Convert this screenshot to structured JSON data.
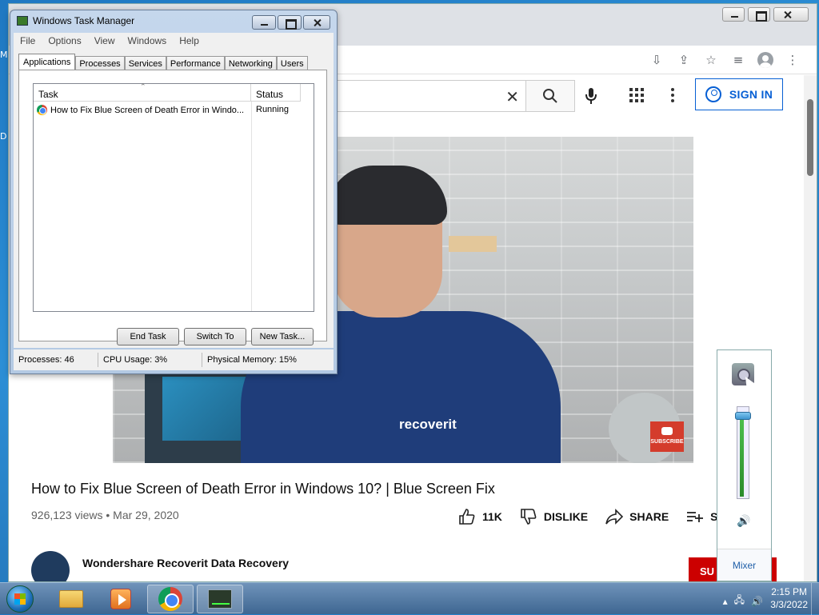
{
  "desktop": {
    "left_fragments": [
      "M",
      "D"
    ]
  },
  "browser": {
    "search": {
      "clear_icon": "close-icon"
    },
    "header": {
      "signin_label": "SIGN IN"
    },
    "video": {
      "logo_text": "recoverit",
      "subscribe_badge": "SUBSCRIBE",
      "title": "How to Fix Blue Screen of Death Error in Windows 10? | Blue Screen Fix",
      "meta": "926,123 views • Mar 29, 2020",
      "actions": {
        "like_count": "11K",
        "dislike_label": "DISLIKE",
        "share_label": "SHARE",
        "save_label": "SA"
      },
      "channel_name": "Wondershare Recoverit Data Recovery",
      "subscribe_button": "SU"
    }
  },
  "task_manager": {
    "title": "Windows Task Manager",
    "menu": [
      "File",
      "Options",
      "View",
      "Windows",
      "Help"
    ],
    "tabs": [
      "Applications",
      "Processes",
      "Services",
      "Performance",
      "Networking",
      "Users"
    ],
    "active_tab": "Applications",
    "columns": {
      "task": "Task",
      "status": "Status"
    },
    "rows": [
      {
        "task": "How to Fix Blue Screen of Death Error in Windo...",
        "status": "Running"
      }
    ],
    "buttons": {
      "end_task": "End Task",
      "switch_to": "Switch To",
      "new_task": "New Task..."
    },
    "statusbar": {
      "processes": "Processes: 46",
      "cpu": "CPU Usage: 3%",
      "memory": "Physical Memory: 15%"
    }
  },
  "volume_popup": {
    "level_percent": 95,
    "mixer_label": "Mixer"
  },
  "taskbar": {
    "clock": {
      "time": "2:15 PM",
      "date": "3/3/2022"
    },
    "pinned": [
      "folder-icon",
      "media-player-icon",
      "chrome-icon",
      "task-manager-icon"
    ]
  },
  "colors": {
    "accent": "#065fd4",
    "subscribe": "#cc0000",
    "taskbar": "#3e6691"
  }
}
